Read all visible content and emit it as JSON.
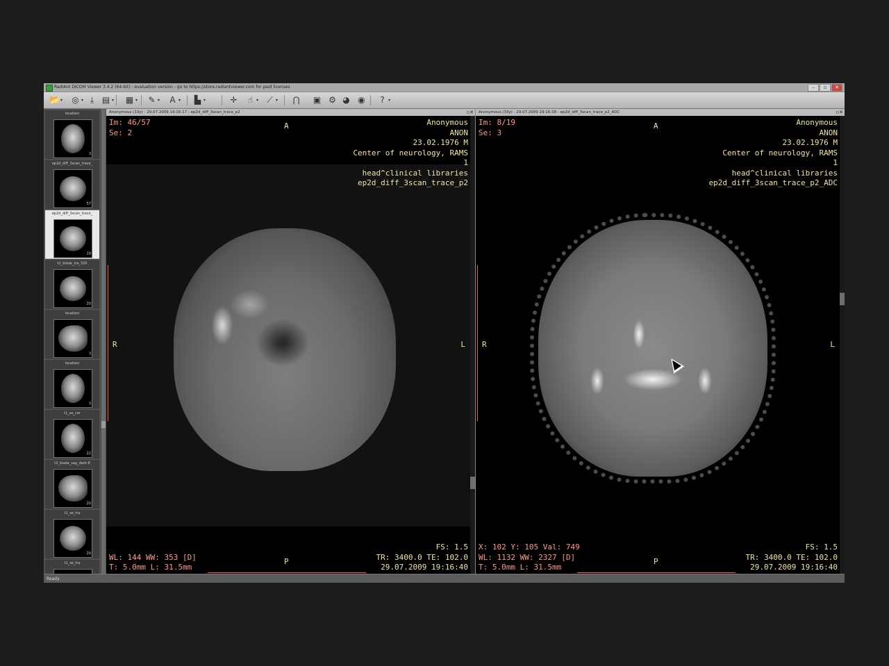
{
  "app": {
    "title": "RadiAnt DICOM Viewer 3.4.2 (64-bit) - evaluation version - go to https://store.radiantviewer.com for paid licenses",
    "window_controls": [
      "–",
      "▫",
      "✕"
    ]
  },
  "toolbar": {
    "icons": [
      "open-folder-icon",
      "cd-icon",
      "download-icon",
      "save-icon",
      "layout-icon",
      "pen-icon",
      "text-icon",
      "brush-icon",
      "crosshair-icon",
      "move-icon",
      "measure-icon",
      "arch-icon",
      "film-icon",
      "gear-icon",
      "globe-icon",
      "coin-icon",
      "help-icon"
    ]
  },
  "thumbnails": [
    {
      "label": "localizer",
      "count": "3",
      "kind": "cor",
      "selected": false
    },
    {
      "label": "ep2d_diff_3scan_trace_",
      "count": "57",
      "kind": "axial",
      "selected": false
    },
    {
      "label": "ep2d_diff_3scan_trace_",
      "count": "19",
      "kind": "axial",
      "selected": true
    },
    {
      "label": "t2_blade_tra_320",
      "count": "20",
      "kind": "axial",
      "selected": false
    },
    {
      "label": "localizer",
      "count": "3",
      "kind": "sag",
      "selected": false
    },
    {
      "label": "localizer",
      "count": "3",
      "kind": "cor",
      "selected": false
    },
    {
      "label": "t1_se_cor",
      "count": "22",
      "kind": "cor",
      "selected": false
    },
    {
      "label": "t2_blade_sag_dark-fl",
      "count": "20",
      "kind": "sag",
      "selected": false
    },
    {
      "label": "t1_se_tra",
      "count": "20",
      "kind": "axial",
      "selected": false
    },
    {
      "label": "t1_se_tra",
      "count": "",
      "kind": "axial",
      "selected": false
    }
  ],
  "viewports": [
    {
      "header": "Anonymous (33y) - 29.07.2009 19:16:17 - ep2d_diff_3scan_trace_p2",
      "im": "Im: 46/57",
      "se": "Se: 2",
      "patient": [
        "Anonymous",
        "ANON",
        "23.02.1976 M",
        "Center of neurology, RAMS",
        "1",
        "head^clinical libraries",
        "ep2d_diff_3scan_trace_p2"
      ],
      "orientation": {
        "top": "A",
        "bottom": "P",
        "left": "R",
        "right": "L"
      },
      "bottom_left": [
        "",
        "WL: 144 WW: 353 [D]",
        "T: 5.0mm L: 31.5mm"
      ],
      "bottom_right": [
        "FS: 1.5",
        "TR: 3400.0 TE: 102.0",
        "29.07.2009 19:16:40"
      ]
    },
    {
      "header": "Anonymous (33y) - 29.07.2009 19:16:38 - ep2d_diff_3scan_trace_p2_ADC",
      "im": "Im: 8/19",
      "se": "Se: 3",
      "patient": [
        "Anonymous",
        "ANON",
        "23.02.1976 M",
        "Center of neurology, RAMS",
        "1",
        "head^clinical libraries",
        "ep2d_diff_3scan_trace_p2_ADC"
      ],
      "orientation": {
        "top": "A",
        "bottom": "P",
        "left": "R",
        "right": "L"
      },
      "bottom_left": [
        "X: 102 Y: 105 Val: 749",
        "WL: 1132 WW: 2327 [D]",
        "T: 5.0mm L: 31.5mm"
      ],
      "bottom_right": [
        "FS: 1.5",
        "TR: 3400.0 TE: 102.0",
        "29.07.2009 19:16:40"
      ]
    }
  ],
  "statusbar": {
    "text": "Ready"
  },
  "glyphs": {
    "open-folder-icon": "📂",
    "cd-icon": "◎",
    "download-icon": "⤓",
    "save-icon": "▤",
    "layout-icon": "▦",
    "pen-icon": "✎",
    "text-icon": "A",
    "brush-icon": "▙",
    "crosshair-icon": "✛",
    "move-icon": "☝",
    "measure-icon": "⟋",
    "arch-icon": "⋂",
    "film-icon": "▣",
    "gear-icon": "⚙",
    "globe-icon": "◕",
    "coin-icon": "◉",
    "help-icon": "?"
  }
}
